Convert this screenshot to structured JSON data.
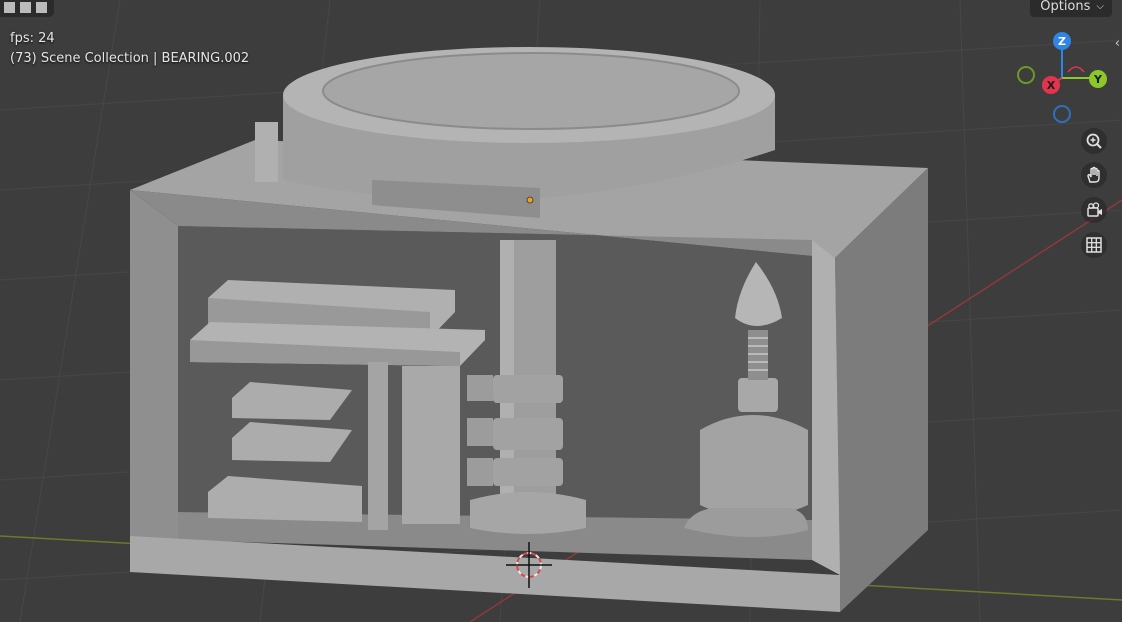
{
  "viewport": {
    "fps_text": "fps: 24",
    "collection_text": "(73) Scene Collection | BEARING.002"
  },
  "header": {
    "options_label": "Options",
    "options_icon": "chevron-down-icon",
    "mode_icon": "object-mode-icon",
    "sidebar_toggle_icon": "chevron-left-icon"
  },
  "gizmo": {
    "z_label": "Z",
    "y_label": "Y",
    "x_label": "X",
    "colors": {
      "x": "#e2344f",
      "y": "#8bc82a",
      "z": "#2f85e6",
      "neg_y": "#6c9a27",
      "neg_z": "#2f6fbf"
    }
  },
  "navigation": {
    "zoom_icon": "zoom-icon",
    "pan_icon": "hand-pan-icon",
    "camera_icon": "camera-view-icon",
    "ortho_icon": "grid-ortho-icon"
  },
  "colors": {
    "viewport_bg": "#3d3d3d",
    "model_gray": "#9a9a9a",
    "x_axis_line": "#8c3a3a",
    "y_axis_line": "#6a7a2a"
  }
}
